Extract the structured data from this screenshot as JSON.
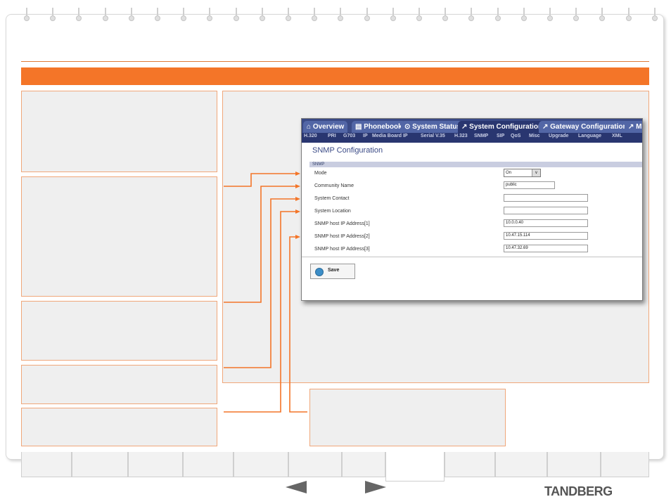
{
  "screenshot": {
    "tabs": [
      {
        "label": "⌂ Overview",
        "active": false
      },
      {
        "label": "▤ Phonebook",
        "active": false
      },
      {
        "label": "⊙ System Status",
        "active": false
      },
      {
        "label": "↗ System Configuration",
        "active": true
      },
      {
        "label": "↗ Gateway Configuration",
        "active": false
      },
      {
        "label": "↗ M",
        "active": false
      }
    ],
    "subnav": [
      {
        "label": "H.320",
        "active": false
      },
      {
        "label": "PRI",
        "active": false
      },
      {
        "label": "G703",
        "active": false
      },
      {
        "label": "IP",
        "active": false
      },
      {
        "label": "Media Board IP",
        "active": false
      },
      {
        "label": "Serial V.35",
        "active": false
      },
      {
        "label": "H.323",
        "active": false
      },
      {
        "label": "SNMP",
        "active": true
      },
      {
        "label": "SIP",
        "active": false
      },
      {
        "label": "QoS",
        "active": false
      },
      {
        "label": "Misc",
        "active": false
      },
      {
        "label": "Upgrade",
        "active": false
      },
      {
        "label": "Language",
        "active": false
      },
      {
        "label": "XML",
        "active": false
      }
    ],
    "page_title": "SNMP Configuration",
    "section_label": "SNMP",
    "fields": [
      {
        "label": "Mode",
        "value": "On",
        "type": "select"
      },
      {
        "label": "Community Name",
        "value": "public",
        "type": "text"
      },
      {
        "label": "System Contact",
        "value": "",
        "type": "text"
      },
      {
        "label": "System Location",
        "value": "",
        "type": "text"
      },
      {
        "label": "SNMP host IP Address[1]",
        "value": "10.0.0.40",
        "type": "text"
      },
      {
        "label": "SNMP host IP Address[2]",
        "value": "10.47.15.114",
        "type": "text"
      },
      {
        "label": "SNMP host IP Address[3]",
        "value": "10.47.32.69",
        "type": "text"
      }
    ],
    "save_label": "Save",
    "select_arrow": "∨"
  },
  "footer": {
    "prev_icon": "left-arrow",
    "next_icon": "right-arrow",
    "brand": "TANDBERG"
  },
  "colors": {
    "accent": "#f47528",
    "panel": "#efefef",
    "tab_bar": "#3a4a86"
  }
}
